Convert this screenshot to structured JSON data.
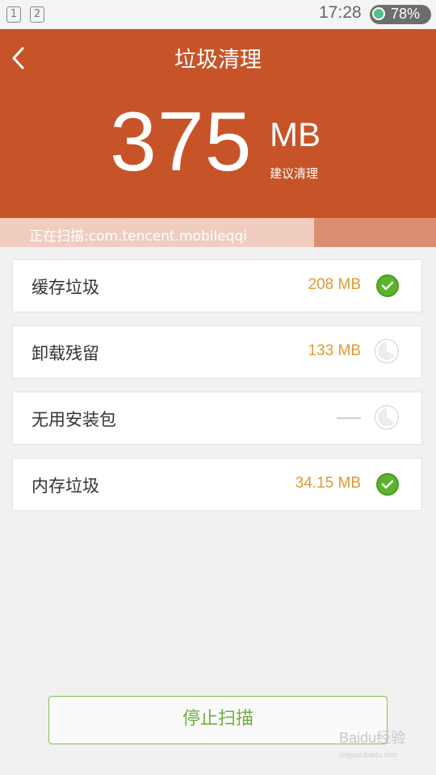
{
  "status_bar": {
    "notification_1": "1",
    "notification_2": "2",
    "time": "17:28",
    "battery": "78%"
  },
  "header": {
    "title": "垃圾清理",
    "size_value": "375",
    "size_unit": "MB",
    "size_hint": "建议清理",
    "scan_status": "正在扫描:com.tencent.mobileqqi",
    "scan_progress": 0.72
  },
  "items": [
    {
      "label": "缓存垃圾",
      "value": "208 MB",
      "state": "checked"
    },
    {
      "label": "卸载残留",
      "value": "133 MB",
      "state": "scanning"
    },
    {
      "label": "无用安装包",
      "value": "—",
      "state": "scanning"
    },
    {
      "label": "内存垃圾",
      "value": "34.15 MB",
      "state": "checked"
    }
  ],
  "stop_button": "停止扫描",
  "colors": {
    "header_bg": "#c75428",
    "accent_green": "#5cb42d",
    "value_orange": "#e09a30"
  },
  "watermark": {
    "text": "Baidu经验",
    "sub": "jingyan.baidu.com"
  }
}
